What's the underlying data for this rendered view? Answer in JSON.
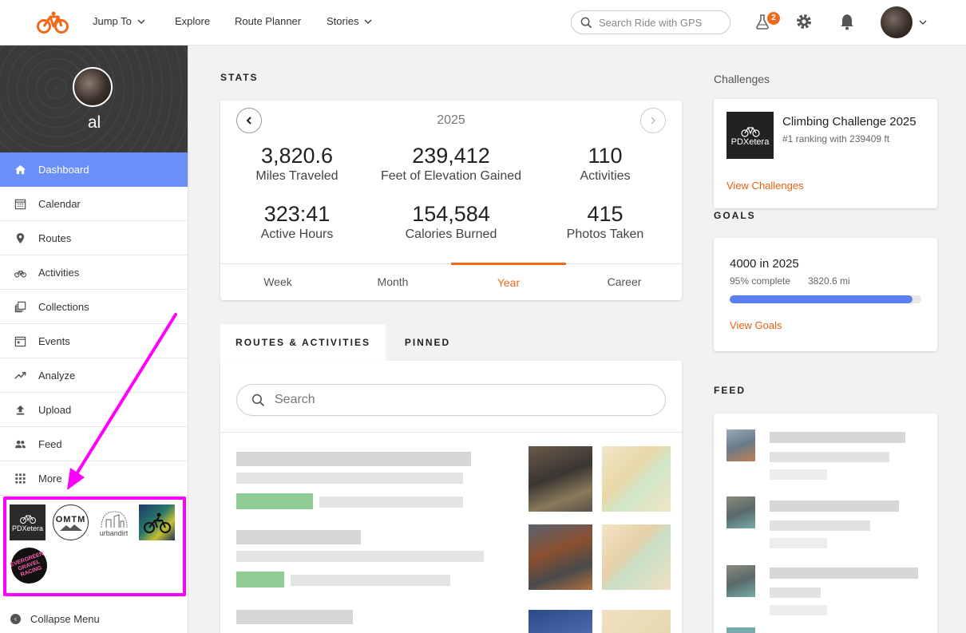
{
  "topnav": {
    "jump_to": "Jump To",
    "explore": "Explore",
    "route_planner": "Route Planner",
    "stories": "Stories",
    "search_placeholder": "Search Ride with GPS",
    "lab_badge": "2",
    "accent_color": "#f06a1d"
  },
  "sidebar": {
    "user_name": "al",
    "items": [
      {
        "label": "Dashboard",
        "icon": "home-icon"
      },
      {
        "label": "Calendar",
        "icon": "calendar-icon"
      },
      {
        "label": "Routes",
        "icon": "map-pin-icon"
      },
      {
        "label": "Activities",
        "icon": "bicycle-icon"
      },
      {
        "label": "Collections",
        "icon": "collections-icon"
      },
      {
        "label": "Events",
        "icon": "events-icon"
      },
      {
        "label": "Analyze",
        "icon": "trend-icon"
      },
      {
        "label": "Upload",
        "icon": "upload-icon"
      },
      {
        "label": "Feed",
        "icon": "people-icon"
      },
      {
        "label": "More",
        "icon": "grid-icon"
      }
    ],
    "clubs": {
      "pdxetera": "PDXetera",
      "omtm": "OMTM",
      "urbandirt": "urbandirt",
      "evergreen_line1": "EVERGREEN",
      "evergreen_line2": "GRAVEL",
      "evergreen_line3": "RACING"
    },
    "collapse_label": "Collapse Menu",
    "annotation_color": "#ff00ff"
  },
  "stats": {
    "section_title": "STATS",
    "year": "2025",
    "items": [
      {
        "value": "3,820.6",
        "label": "Miles Traveled"
      },
      {
        "value": "239,412",
        "label": "Feet of Elevation Gained"
      },
      {
        "value": "110",
        "label": "Activities"
      },
      {
        "value": "323:41",
        "label": "Active Hours"
      },
      {
        "value": "154,584",
        "label": "Calories Burned"
      },
      {
        "value": "415",
        "label": "Photos Taken"
      }
    ],
    "tabs": [
      "Week",
      "Month",
      "Year",
      "Career"
    ],
    "active_tab": "Year"
  },
  "routes_activities": {
    "tab_routes": "ROUTES & ACTIVITIES",
    "tab_pinned": "PINNED",
    "search_placeholder": "Search"
  },
  "challenges": {
    "section_title": "Challenges",
    "logo_text": "PDXetera",
    "name": "Climbing Challenge 2025",
    "detail": "#1 ranking with 239409 ft",
    "link": "View Challenges"
  },
  "goals": {
    "section_title": "GOALS",
    "name": "4000 in 2025",
    "percent_label": "95% complete",
    "distance": "3820.6 mi",
    "progress": 0.955,
    "progress_color": "#5b7ff0",
    "link": "View Goals"
  },
  "feed": {
    "section_title": "FEED"
  }
}
